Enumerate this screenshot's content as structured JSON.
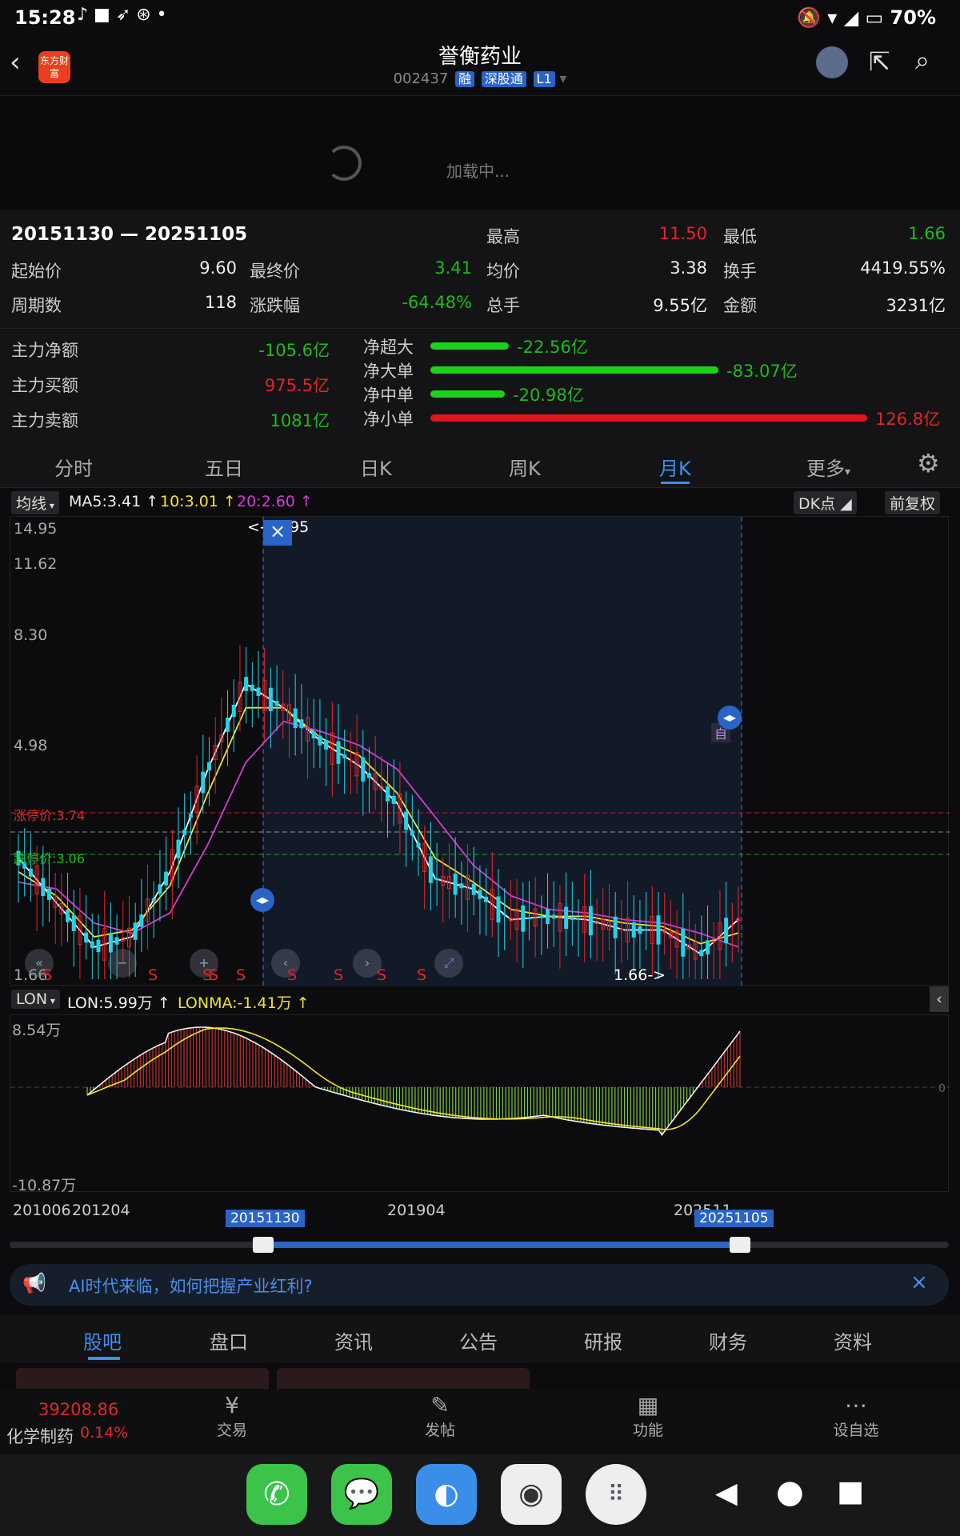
{
  "status_bar": {
    "time": "15:28",
    "battery": "70%"
  },
  "header": {
    "title": "誉衡药业",
    "code": "002437",
    "tags": [
      "融",
      "深股通",
      "L1"
    ],
    "logo_text": "东方财富"
  },
  "loading_text": "加载中...",
  "range": {
    "period": "20151130 — 20251105",
    "high_label": "最高",
    "high": "11.50",
    "low_label": "最低",
    "low": "1.66",
    "start_label": "起始价",
    "start": "9.60",
    "end_label": "最终价",
    "end": "3.41",
    "avg_label": "均价",
    "avg": "3.38",
    "turnover_label": "换手",
    "turnover": "4419.55%",
    "periods_label": "周期数",
    "periods": "118",
    "change_label": "涨跌幅",
    "change": "-64.48%",
    "hands_label": "总手",
    "hands": "9.55亿",
    "amount_label": "金额",
    "amount": "3231亿"
  },
  "fund_flow": {
    "net_label": "主力净额",
    "net": "-105.6亿",
    "buy_label": "主力买额",
    "buy": "975.5亿",
    "sell_label": "主力卖额",
    "sell": "1081亿",
    "rows": [
      {
        "label": "净超大",
        "value": "-22.56亿",
        "fraction": 0.18,
        "color": "#1cd11c"
      },
      {
        "label": "净大单",
        "value": "-83.07亿",
        "fraction": 0.66,
        "color": "#1cd11c"
      },
      {
        "label": "净中单",
        "value": "-20.98亿",
        "fraction": 0.17,
        "color": "#1cd11c"
      },
      {
        "label": "净小单",
        "value": "126.8亿",
        "fraction": 1.0,
        "color": "#e0161a"
      }
    ]
  },
  "ktabs": [
    "分时",
    "五日",
    "日K",
    "周K",
    "月K",
    "更多"
  ],
  "ktab_active": "月K",
  "ma_bar": {
    "selector": "均线",
    "ma5": "MA5:3.41",
    "ma10": "10:3.01",
    "ma20": "20:2.60",
    "dk": "DK点",
    "adjust": "前复权"
  },
  "main_chart": {
    "y_labels": [
      "14.95",
      "11.62",
      "8.30",
      "4.98",
      "1.66"
    ],
    "max_mark": "<-14.95",
    "min_mark": "1.66->",
    "limit_up": "涨停价:3.74",
    "limit_down": "跌停价:3.06",
    "self_tag": "自",
    "s_marks": [
      "S",
      "S",
      "S",
      "S",
      "S",
      "S",
      "S",
      "S",
      "S"
    ]
  },
  "chart_data": {
    "type": "line",
    "title": "",
    "ylabel": "",
    "ylim": [
      1.66,
      14.95
    ],
    "series": [
      {
        "name": "MA5",
        "color": "#ffffff",
        "values": [
          5.2,
          3.9,
          2.6,
          2.9,
          4.8,
          7.8,
          10.3,
          9.6,
          8.6,
          7.9,
          6.8,
          4.6,
          4.3,
          3.4,
          3.5,
          3.4,
          3.1,
          3.1,
          2.4,
          3.41
        ]
      },
      {
        "name": "10",
        "color": "#f2e233",
        "values": [
          4.8,
          4.1,
          2.9,
          3.1,
          4.4,
          7.1,
          9.6,
          9.6,
          8.7,
          8.2,
          7.1,
          5.2,
          4.5,
          3.7,
          3.5,
          3.5,
          3.3,
          3.2,
          2.7,
          3.01
        ]
      },
      {
        "name": "20",
        "color": "#d23cd2",
        "values": [
          4.5,
          4.3,
          3.3,
          3.0,
          3.6,
          5.6,
          8.0,
          9.2,
          8.9,
          8.5,
          7.8,
          6.4,
          5.0,
          4.1,
          3.7,
          3.6,
          3.4,
          3.3,
          3.0,
          2.6
        ]
      }
    ]
  },
  "lon": {
    "selector": "LON",
    "lon": "LON:5.99万",
    "lonma": "LONMA:-1.41万",
    "top": "8.54万",
    "bottom": "-10.87万",
    "zero": "0"
  },
  "timeline": {
    "ticks": [
      "201006",
      "201204",
      "201904",
      "202511"
    ],
    "start": "20151130",
    "end": "20251105"
  },
  "banner": "AI时代来临，如何把握产业红利?",
  "bottom_tabs": [
    "股吧",
    "盘口",
    "资讯",
    "公告",
    "研报",
    "财务",
    "资料"
  ],
  "bottom_tab_active": "股吧",
  "footer": {
    "index_value": "39208.86",
    "index_name": "化学制药",
    "index_change": "0.14%",
    "actions": [
      "交易",
      "发帖",
      "功能",
      "设自选"
    ]
  }
}
